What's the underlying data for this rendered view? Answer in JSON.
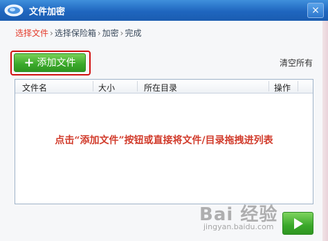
{
  "window": {
    "title": "文件加密",
    "close_glyph": "×"
  },
  "steps": [
    {
      "label": "选择文件",
      "current": true
    },
    {
      "label": "选择保险箱",
      "current": false
    },
    {
      "label": "加密",
      "current": false
    },
    {
      "label": "完成",
      "current": false
    }
  ],
  "steps_separator": "›",
  "toolbar": {
    "add_plus": "+",
    "add_label": "添加文件",
    "clear_label": "清空所有"
  },
  "table": {
    "columns": [
      "文件名",
      "大小",
      "所在目录",
      "操作"
    ],
    "hint": "点击“添加文件”按钮或直接将文件/目录拖拽进列表"
  },
  "watermark": {
    "brand": "Bai 经验",
    "url": "jingyan.baidu.com"
  },
  "colors": {
    "accent_green": "#3aa82a",
    "highlight_red": "#d10f0f",
    "hint_red": "#d13b2b",
    "title_blue": "#1f66bf"
  }
}
